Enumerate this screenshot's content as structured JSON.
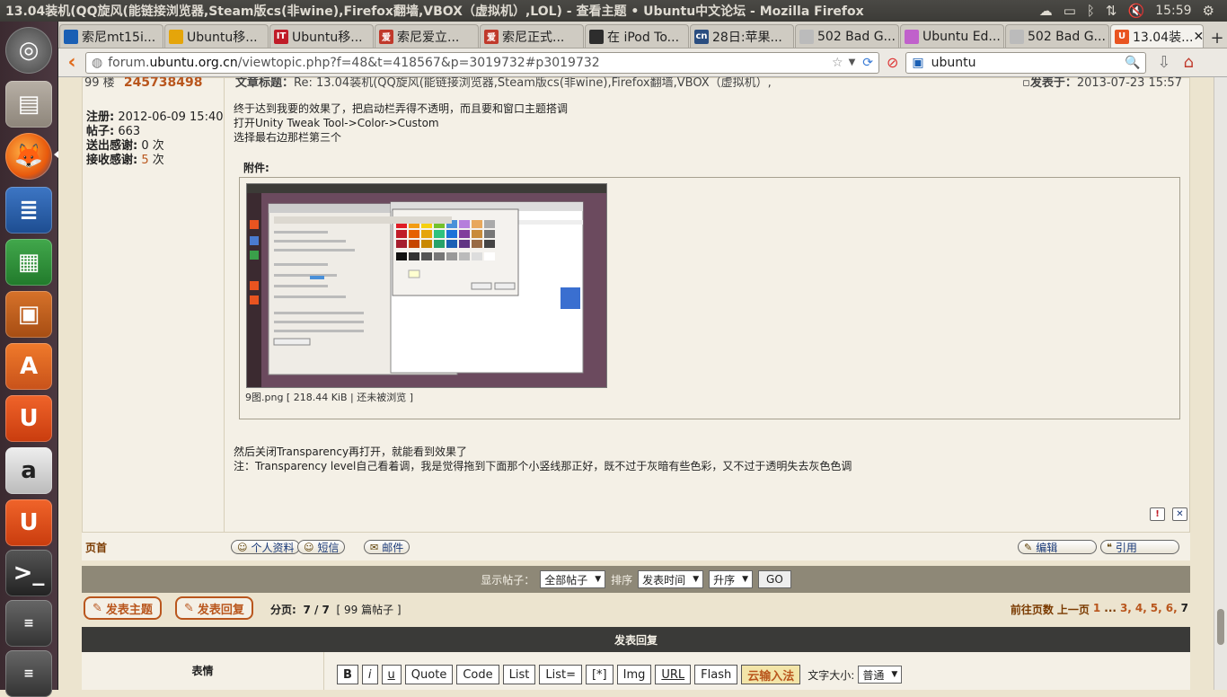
{
  "window": {
    "title": "13.04装机(QQ旋风(能链接浏览器,Steam版cs(非wine),Firefox翻墙,VBOX（虚拟机）,LOL) - 查看主题 • Ubuntu中文论坛 - Mozilla Firefox"
  },
  "tray": {
    "time": "15:59"
  },
  "tabs": [
    {
      "label": "索尼mt15i...",
      "fav_color": "#1a5fb4",
      "fav_text": ""
    },
    {
      "label": "Ubuntu移...",
      "fav_color": "#e5a50a",
      "fav_text": ""
    },
    {
      "label": "Ubuntu移...",
      "fav_color": "#c01c28",
      "fav_text": "IT"
    },
    {
      "label": "索尼爱立...",
      "fav_color": "#c0392b",
      "fav_text": "爱"
    },
    {
      "label": "索尼正式...",
      "fav_color": "#c0392b",
      "fav_text": "爱"
    },
    {
      "label": "在 iPod To...",
      "fav_color": "#2d2d2d",
      "fav_text": ""
    },
    {
      "label": "28日:苹果...",
      "fav_color": "#2a4d80",
      "fav_text": "cn"
    },
    {
      "label": "502 Bad G...",
      "fav_color": "#bbbbbb",
      "fav_text": ""
    },
    {
      "label": "Ubuntu Ed...",
      "fav_color": "#c061cb",
      "fav_text": ""
    },
    {
      "label": "502 Bad G...",
      "fav_color": "#bbbbbb",
      "fav_text": ""
    },
    {
      "label": "13.04装...",
      "fav_color": "#e95420",
      "fav_text": "U"
    }
  ],
  "nav": {
    "url_prefix": "forum.",
    "url_domain": "ubuntu.org.cn",
    "url_path": "/viewtopic.php?f=48&t=418567&p=3019732#p3019732",
    "search_value": "ubuntu"
  },
  "post": {
    "floor": "99 楼",
    "post_num": "245738498",
    "subject_label": "文章标题：",
    "subject": "Re: 13.04装机(QQ旋风(能链接浏览器,Steam版cs(非wine),Firefox翻墙,VBOX（虚拟机）,",
    "date_label": "发表于：",
    "date": "2013-07-23 15:57",
    "user": {
      "reg_label": "注册:",
      "reg": "2012-06-09 15:40",
      "posts_label": "帖子:",
      "posts": "663",
      "thanks_sent_label": "送出感谢:",
      "thanks_sent": "0 次",
      "thanks_recv_label": "接收感谢:",
      "thanks_recv_num": "5",
      "thanks_recv_unit": " 次"
    },
    "lines": [
      "终于达到我要的效果了，把启动栏弄得不透明，而且要和窗口主题搭调",
      "打开Unity Tweak Tool->Color->Custom",
      "选择最右边那栏第三个"
    ],
    "attachment_label": "附件:",
    "attachment_caption": "9图.png [ 218.44 KiB | 还未被浏览 ]",
    "after_lines": [
      "然后关闭Transparency再打开，就能看到效果了",
      "注：Transparency level自己看着调，我是觉得拖到下面那个小竖线那正好，既不过于灰暗有些色彩，又不过于透明失去灰色色调"
    ],
    "first_page": "页首",
    "buttons": {
      "profile": "个人资料",
      "pm": "短信",
      "email": "邮件",
      "edit": "编辑",
      "quote": "引用"
    }
  },
  "options": {
    "show_label": "显示帖子：",
    "show_value": "全部帖子",
    "sort_label": "排序",
    "sort_value": "发表时间",
    "order_value": "升序",
    "go": "GO"
  },
  "pagination": {
    "new_topic": "发表主题",
    "post_reply": "发表回复",
    "pages_label": "分页:",
    "pages": "7 / 7",
    "count": "[ 99 篇帖子 ]",
    "goto": "前往页数",
    "prev": "上一页",
    "p1": "1",
    "ellipsis": "...",
    "p3": "3,",
    "p4": "4,",
    "p5": "5,",
    "p6": "6,",
    "p7": "7"
  },
  "reply": {
    "header": "发表回复",
    "emoticons": "表情",
    "tools": [
      "B",
      "i",
      "u",
      "Quote",
      "Code",
      "List",
      "List=",
      "[*]",
      "Img",
      "URL",
      "Flash"
    ],
    "cloud_ime": "云输入法",
    "font_size_label": "文字大小:",
    "font_size_value": "普通"
  }
}
